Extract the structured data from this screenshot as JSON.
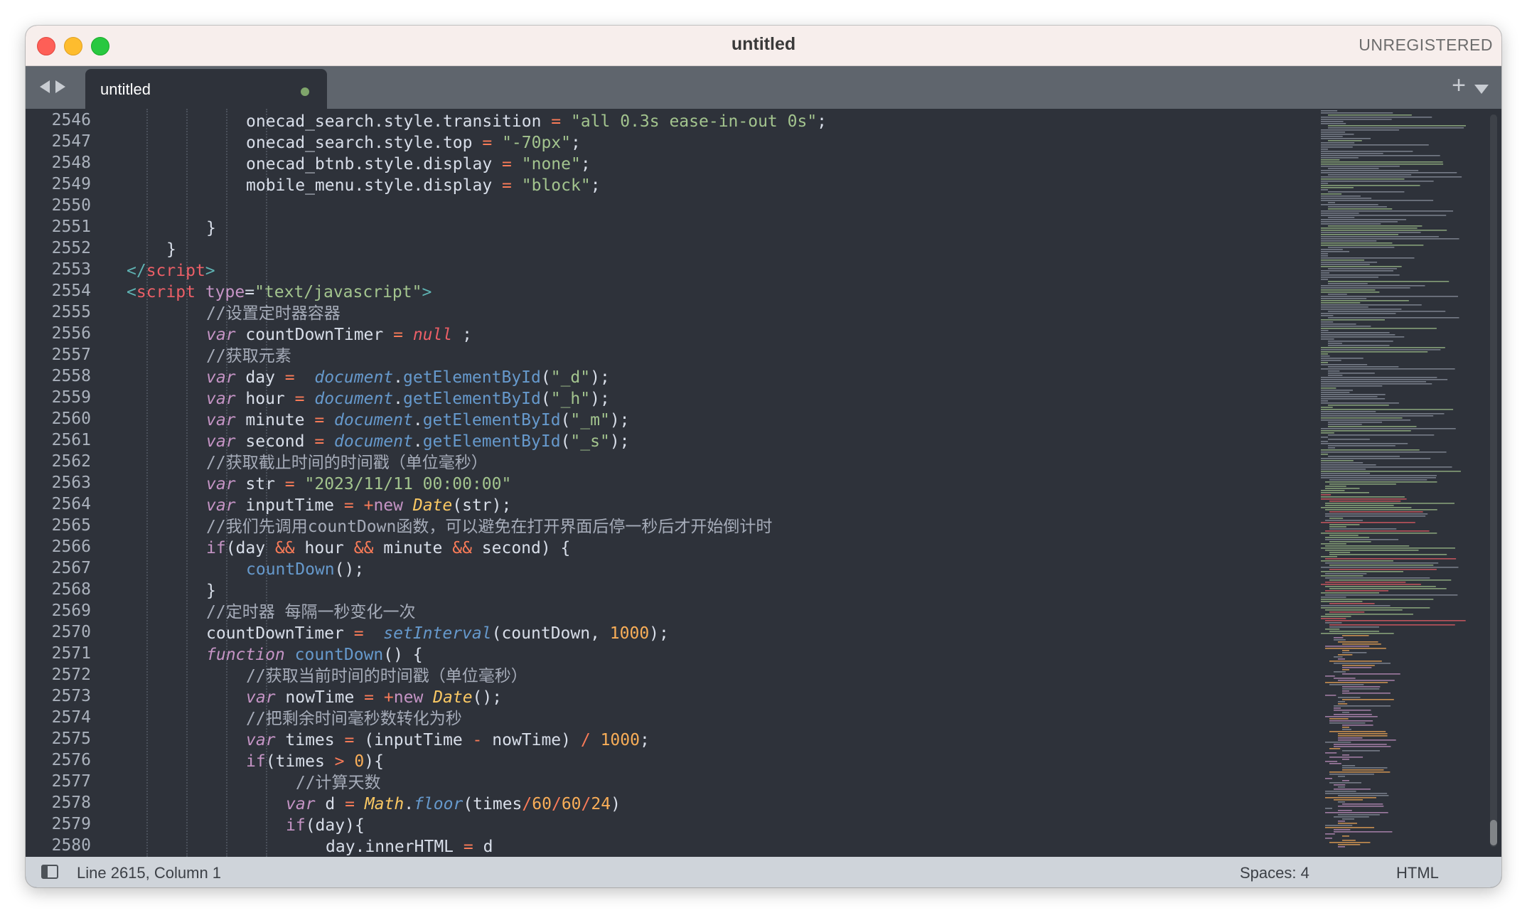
{
  "window": {
    "title": "untitled",
    "license_label": "UNREGISTERED"
  },
  "tabs": [
    {
      "label": "untitled",
      "modified": true
    }
  ],
  "editor": {
    "line_numbers": [
      "2546",
      "2547",
      "2548",
      "2549",
      "2550",
      "2551",
      "2552",
      "2553",
      "2554",
      "2555",
      "2556",
      "2557",
      "2558",
      "2559",
      "2560",
      "2561",
      "2562",
      "2563",
      "2564",
      "2565",
      "2566",
      "2567",
      "2568",
      "2569",
      "2570",
      "2571",
      "2572",
      "2573",
      "2574",
      "2575",
      "2576",
      "2577",
      "2578",
      "2579",
      "2580"
    ],
    "lines": [
      {
        "indent": 3,
        "tokens": [
          [
            "",
            "onecad_search.style.transition "
          ],
          [
            "op",
            "="
          ],
          [
            "",
            " "
          ],
          [
            "str",
            "\"all 0.3s ease-in-out 0s\""
          ],
          [
            "",
            ";"
          ]
        ]
      },
      {
        "indent": 3,
        "tokens": [
          [
            "",
            "onecad_search.style.top "
          ],
          [
            "op",
            "="
          ],
          [
            "",
            " "
          ],
          [
            "str",
            "\"-70px\""
          ],
          [
            "",
            ";"
          ]
        ]
      },
      {
        "indent": 3,
        "tokens": [
          [
            "",
            "onecad_btnb.style.display "
          ],
          [
            "op",
            "="
          ],
          [
            "",
            " "
          ],
          [
            "str",
            "\"none\""
          ],
          [
            "",
            ";"
          ]
        ]
      },
      {
        "indent": 3,
        "tokens": [
          [
            "",
            "mobile_menu.style.display "
          ],
          [
            "op",
            "="
          ],
          [
            "",
            " "
          ],
          [
            "str",
            "\"block\""
          ],
          [
            "",
            ";"
          ]
        ]
      },
      {
        "indent": 0,
        "tokens": []
      },
      {
        "indent": 2,
        "tokens": [
          [
            "",
            "}"
          ]
        ]
      },
      {
        "indent": 1,
        "tokens": [
          [
            "",
            "}"
          ]
        ]
      },
      {
        "indent": 0,
        "tokens": [
          [
            "punct",
            "</"
          ],
          [
            "tag",
            "script"
          ],
          [
            "punct",
            ">"
          ]
        ]
      },
      {
        "indent": 0,
        "tokens": [
          [
            "punct",
            "<"
          ],
          [
            "tag",
            "script"
          ],
          [
            "",
            " "
          ],
          [
            "attr",
            "type"
          ],
          [
            "",
            "="
          ],
          [
            "str",
            "\"text/javascript\""
          ],
          [
            "punct",
            ">"
          ]
        ]
      },
      {
        "indent": 2,
        "tokens": [
          [
            "cmt",
            "//设置定时器容器"
          ]
        ]
      },
      {
        "indent": 2,
        "tokens": [
          [
            "kw",
            "var"
          ],
          [
            "",
            " countDownTimer "
          ],
          [
            "op",
            "="
          ],
          [
            "",
            " "
          ],
          [
            "null",
            "null"
          ],
          [
            "",
            " ;"
          ]
        ]
      },
      {
        "indent": 2,
        "tokens": [
          [
            "cmt",
            "//获取元素"
          ]
        ]
      },
      {
        "indent": 2,
        "tokens": [
          [
            "kw",
            "var"
          ],
          [
            "",
            " day "
          ],
          [
            "op",
            "="
          ],
          [
            "",
            "  "
          ],
          [
            "obj",
            "document"
          ],
          [
            "",
            "."
          ],
          [
            "fn",
            "getElementById"
          ],
          [
            "",
            "("
          ],
          [
            "str",
            "\"_d\""
          ],
          [
            "",
            ");"
          ]
        ]
      },
      {
        "indent": 2,
        "tokens": [
          [
            "kw",
            "var"
          ],
          [
            "",
            " hour "
          ],
          [
            "op",
            "="
          ],
          [
            "",
            " "
          ],
          [
            "obj",
            "document"
          ],
          [
            "",
            "."
          ],
          [
            "fn",
            "getElementById"
          ],
          [
            "",
            "("
          ],
          [
            "str",
            "\"_h\""
          ],
          [
            "",
            ");"
          ]
        ]
      },
      {
        "indent": 2,
        "tokens": [
          [
            "kw",
            "var"
          ],
          [
            "",
            " minute "
          ],
          [
            "op",
            "="
          ],
          [
            "",
            " "
          ],
          [
            "obj",
            "document"
          ],
          [
            "",
            "."
          ],
          [
            "fn",
            "getElementById"
          ],
          [
            "",
            "("
          ],
          [
            "str",
            "\"_m\""
          ],
          [
            "",
            ");"
          ]
        ]
      },
      {
        "indent": 2,
        "tokens": [
          [
            "kw",
            "var"
          ],
          [
            "",
            " second "
          ],
          [
            "op",
            "="
          ],
          [
            "",
            " "
          ],
          [
            "obj",
            "document"
          ],
          [
            "",
            "."
          ],
          [
            "fn",
            "getElementById"
          ],
          [
            "",
            "("
          ],
          [
            "str",
            "\"_s\""
          ],
          [
            "",
            ");"
          ]
        ]
      },
      {
        "indent": 2,
        "tokens": [
          [
            "cmt",
            "//获取截止时间的时间戳（单位毫秒）"
          ]
        ]
      },
      {
        "indent": 2,
        "tokens": [
          [
            "kw",
            "var"
          ],
          [
            "",
            " str "
          ],
          [
            "op",
            "="
          ],
          [
            "",
            " "
          ],
          [
            "str",
            "\"2023/11/11 00:00:00\""
          ]
        ]
      },
      {
        "indent": 2,
        "tokens": [
          [
            "kw",
            "var"
          ],
          [
            "",
            " inputTime "
          ],
          [
            "op",
            "="
          ],
          [
            "",
            " "
          ],
          [
            "op",
            "+"
          ],
          [
            "ctrl",
            "new"
          ],
          [
            "",
            " "
          ],
          [
            "cls",
            "Date"
          ],
          [
            "",
            "(str);"
          ]
        ]
      },
      {
        "indent": 2,
        "tokens": [
          [
            "cmt",
            "//我们先调用countDown函数，可以避免在打开界面后停一秒后才开始倒计时"
          ]
        ]
      },
      {
        "indent": 2,
        "tokens": [
          [
            "ctrl",
            "if"
          ],
          [
            "",
            "(day "
          ],
          [
            "op",
            "&&"
          ],
          [
            "",
            " hour "
          ],
          [
            "op",
            "&&"
          ],
          [
            "",
            " minute "
          ],
          [
            "op",
            "&&"
          ],
          [
            "",
            " second) {"
          ]
        ]
      },
      {
        "indent": 3,
        "tokens": [
          [
            "fn",
            "countDown"
          ],
          [
            "",
            "();"
          ]
        ]
      },
      {
        "indent": 2,
        "tokens": [
          [
            "",
            "}"
          ]
        ]
      },
      {
        "indent": 2,
        "tokens": [
          [
            "cmt",
            "//定时器 每隔一秒变化一次"
          ]
        ]
      },
      {
        "indent": 2,
        "tokens": [
          [
            "",
            "countDownTimer "
          ],
          [
            "op",
            "="
          ],
          [
            "",
            "  "
          ],
          [
            "obj",
            "setInterval"
          ],
          [
            "",
            "(countDown, "
          ],
          [
            "num",
            "1000"
          ],
          [
            "",
            ");"
          ]
        ]
      },
      {
        "indent": 2,
        "tokens": [
          [
            "kw",
            "function"
          ],
          [
            "",
            " "
          ],
          [
            "fn",
            "countDown"
          ],
          [
            "",
            "() {"
          ]
        ]
      },
      {
        "indent": 3,
        "tokens": [
          [
            "cmt",
            "//获取当前时间的时间戳（单位毫秒）"
          ]
        ]
      },
      {
        "indent": 3,
        "tokens": [
          [
            "kw",
            "var"
          ],
          [
            "",
            " nowTime "
          ],
          [
            "op",
            "="
          ],
          [
            "",
            " "
          ],
          [
            "op",
            "+"
          ],
          [
            "ctrl",
            "new"
          ],
          [
            "",
            " "
          ],
          [
            "cls",
            "Date"
          ],
          [
            "",
            "();"
          ]
        ]
      },
      {
        "indent": 3,
        "tokens": [
          [
            "cmt",
            "//把剩余时间毫秒数转化为秒"
          ]
        ]
      },
      {
        "indent": 3,
        "tokens": [
          [
            "kw",
            "var"
          ],
          [
            "",
            " times "
          ],
          [
            "op",
            "="
          ],
          [
            "",
            " (inputTime "
          ],
          [
            "op",
            "-"
          ],
          [
            "",
            " nowTime) "
          ],
          [
            "op",
            "/"
          ],
          [
            "",
            " "
          ],
          [
            "num",
            "1000"
          ],
          [
            "",
            ";"
          ]
        ]
      },
      {
        "indent": 3,
        "tokens": [
          [
            "ctrl",
            "if"
          ],
          [
            "",
            "(times "
          ],
          [
            "op",
            ">"
          ],
          [
            "",
            " "
          ],
          [
            "num",
            "0"
          ],
          [
            "",
            "){"
          ]
        ]
      },
      {
        "indent": 4,
        "tokens": [
          [
            "cmt",
            " //计算天数"
          ]
        ]
      },
      {
        "indent": 4,
        "tokens": [
          [
            "kw",
            "var"
          ],
          [
            "",
            " d "
          ],
          [
            "op",
            "="
          ],
          [
            "",
            " "
          ],
          [
            "cls",
            "Math"
          ],
          [
            "",
            "."
          ],
          [
            "obj",
            "floor"
          ],
          [
            "",
            "(times"
          ],
          [
            "op",
            "/"
          ],
          [
            "num",
            "60"
          ],
          [
            "op",
            "/"
          ],
          [
            "num",
            "60"
          ],
          [
            "op",
            "/"
          ],
          [
            "num",
            "24"
          ],
          [
            "",
            ")"
          ]
        ]
      },
      {
        "indent": 4,
        "tokens": [
          [
            "ctrl",
            "if"
          ],
          [
            "",
            "(day){"
          ]
        ]
      },
      {
        "indent": 5,
        "tokens": [
          [
            "",
            "day.innerHTML "
          ],
          [
            "op",
            "="
          ],
          [
            "",
            " d"
          ]
        ]
      }
    ]
  },
  "status": {
    "position": "Line 2615, Column 1",
    "indentation": "Spaces: 4",
    "syntax": "HTML"
  },
  "colors": {
    "editor_bg": "#2e323a",
    "titlebar_bg": "#f7eeec",
    "tabbar_bg": "#5f656d",
    "statusbar_bg": "#cfd4da",
    "string": "#a3c48e",
    "keyword": "#c594c5",
    "operator": "#f97b58",
    "number": "#f9ae58",
    "function": "#6699cc",
    "comment": "#a6acb9"
  }
}
